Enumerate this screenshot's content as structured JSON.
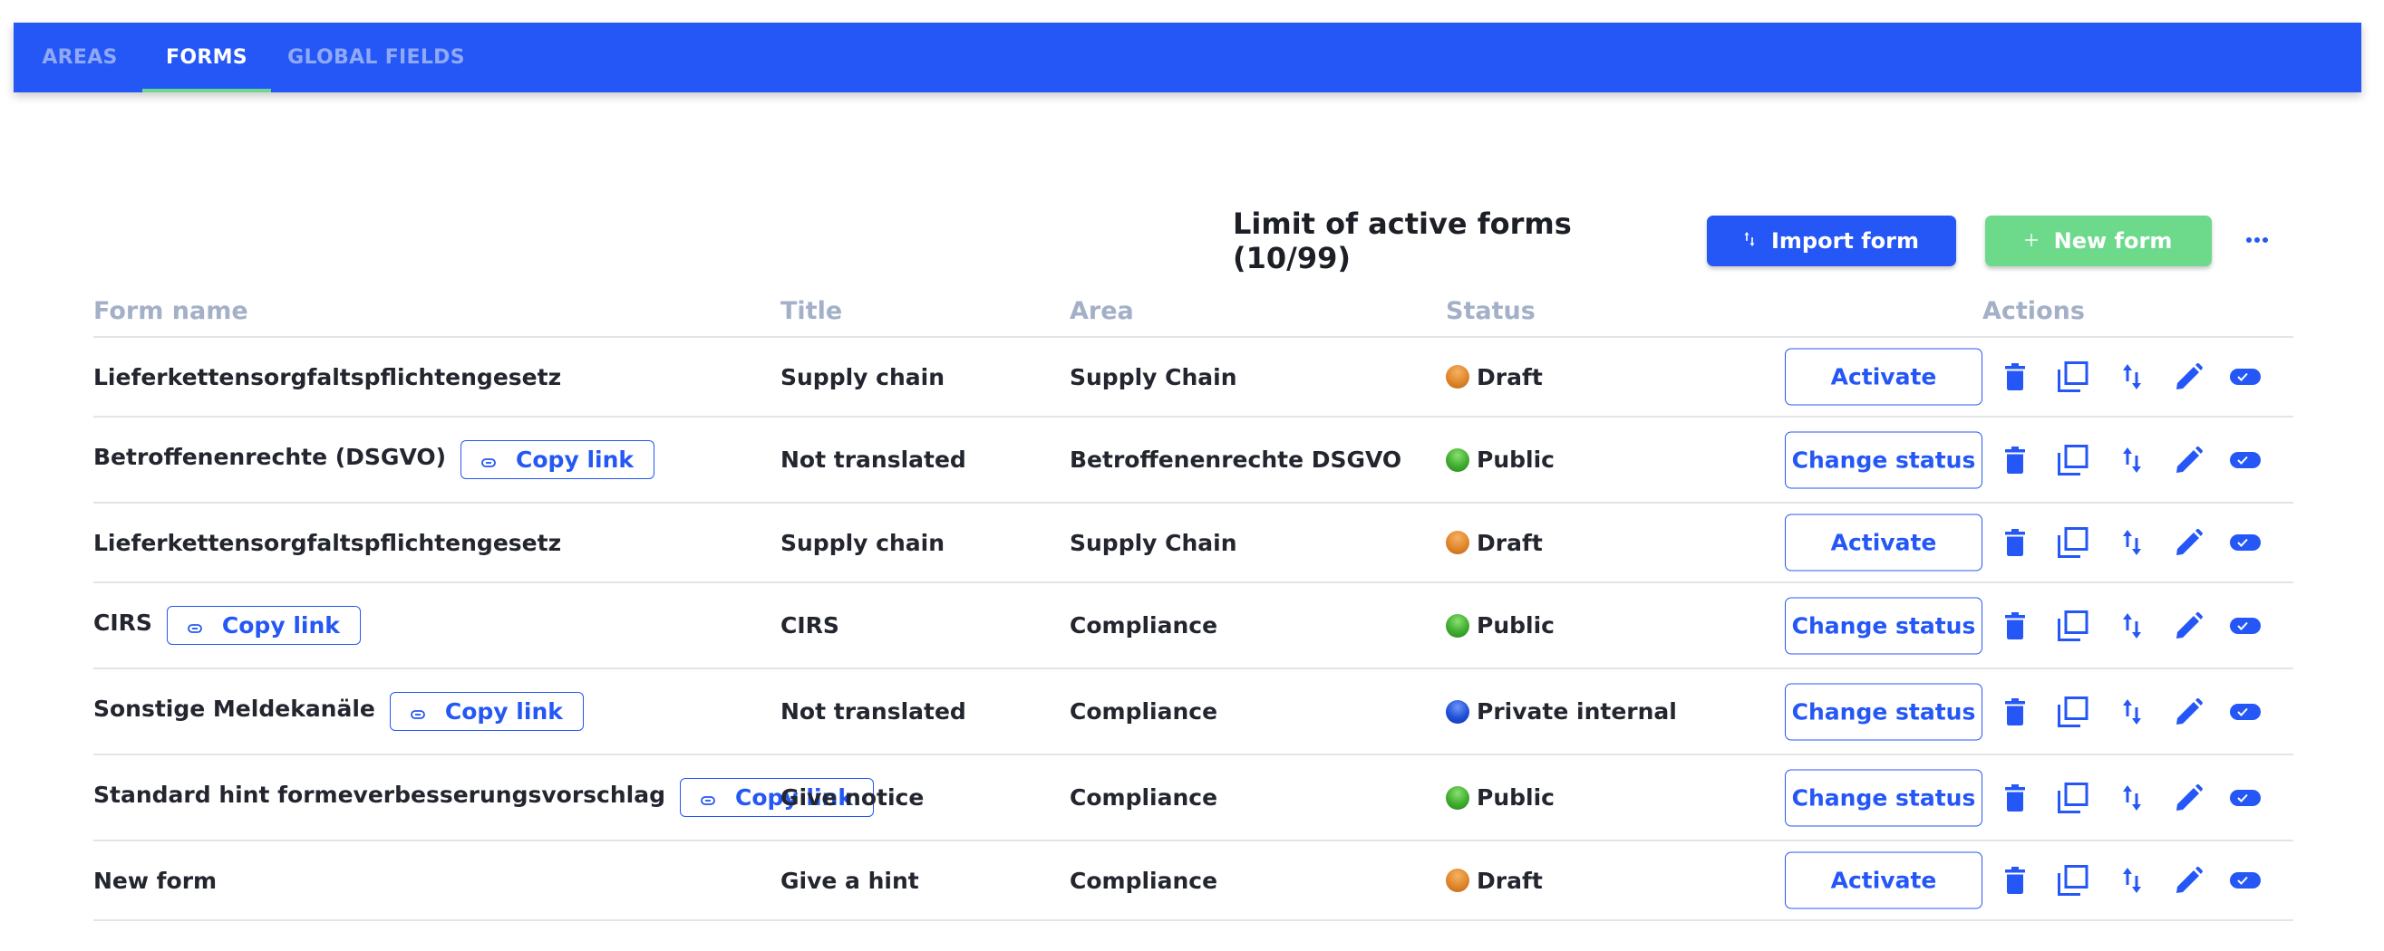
{
  "tabs": [
    {
      "label": "AREAS",
      "active": false
    },
    {
      "label": "FORMS",
      "active": true
    },
    {
      "label": "GLOBAL FIELDS",
      "active": false
    }
  ],
  "toolbar": {
    "limit_label": "Limit of active forms (10/99)",
    "import_label": "Import form",
    "import_icon": "sort-arrows-icon",
    "new_label": "New form",
    "new_icon": "plus-icon",
    "more_icon": "more-dots-icon"
  },
  "colors": {
    "primary": "#2457f5",
    "success": "#6cda8a",
    "header_text": "#a3b0c8",
    "draft": "#e0862a",
    "public": "#3fac2f",
    "private_internal": "#1f4fd8"
  },
  "table": {
    "columns": [
      "Form name",
      "Title",
      "Area",
      "Status",
      "Actions"
    ],
    "copy_link_label": "Copy link",
    "row_icons": [
      "trash-icon",
      "duplicate-icon",
      "sort-arrows-icon",
      "pencil-icon",
      "toggle-check-icon"
    ],
    "rows": [
      {
        "name": "Lieferkettensorgfaltspflichtengesetz",
        "copy_link": false,
        "title": "Supply chain",
        "area": "Supply Chain",
        "status": "Draft",
        "status_key": "draft",
        "action": "Activate"
      },
      {
        "name": "Betroffenenrechte (DSGVO)",
        "copy_link": true,
        "title": "Not translated",
        "area": "Betroffenenrechte DSGVO",
        "status": "Public",
        "status_key": "public",
        "action": "Change status"
      },
      {
        "name": "Lieferkettensorgfaltspflichtengesetz",
        "copy_link": false,
        "title": "Supply chain",
        "area": "Supply Chain",
        "status": "Draft",
        "status_key": "draft",
        "action": "Activate"
      },
      {
        "name": "CIRS",
        "copy_link": true,
        "title": "CIRS",
        "area": "Compliance",
        "status": "Public",
        "status_key": "public",
        "action": "Change status"
      },
      {
        "name": "Sonstige Meldekanäle",
        "copy_link": true,
        "title": "Not translated",
        "area": "Compliance",
        "status": "Private internal",
        "status_key": "private",
        "action": "Change status"
      },
      {
        "name": "Standard hint formeverbesserungsvorschlag",
        "copy_link": true,
        "title": "Give notice",
        "area": "Compliance",
        "status": "Public",
        "status_key": "public",
        "action": "Change status"
      },
      {
        "name": "New form",
        "copy_link": false,
        "title": "Give a hint",
        "area": "Compliance",
        "status": "Draft",
        "status_key": "draft",
        "action": "Activate"
      }
    ]
  }
}
